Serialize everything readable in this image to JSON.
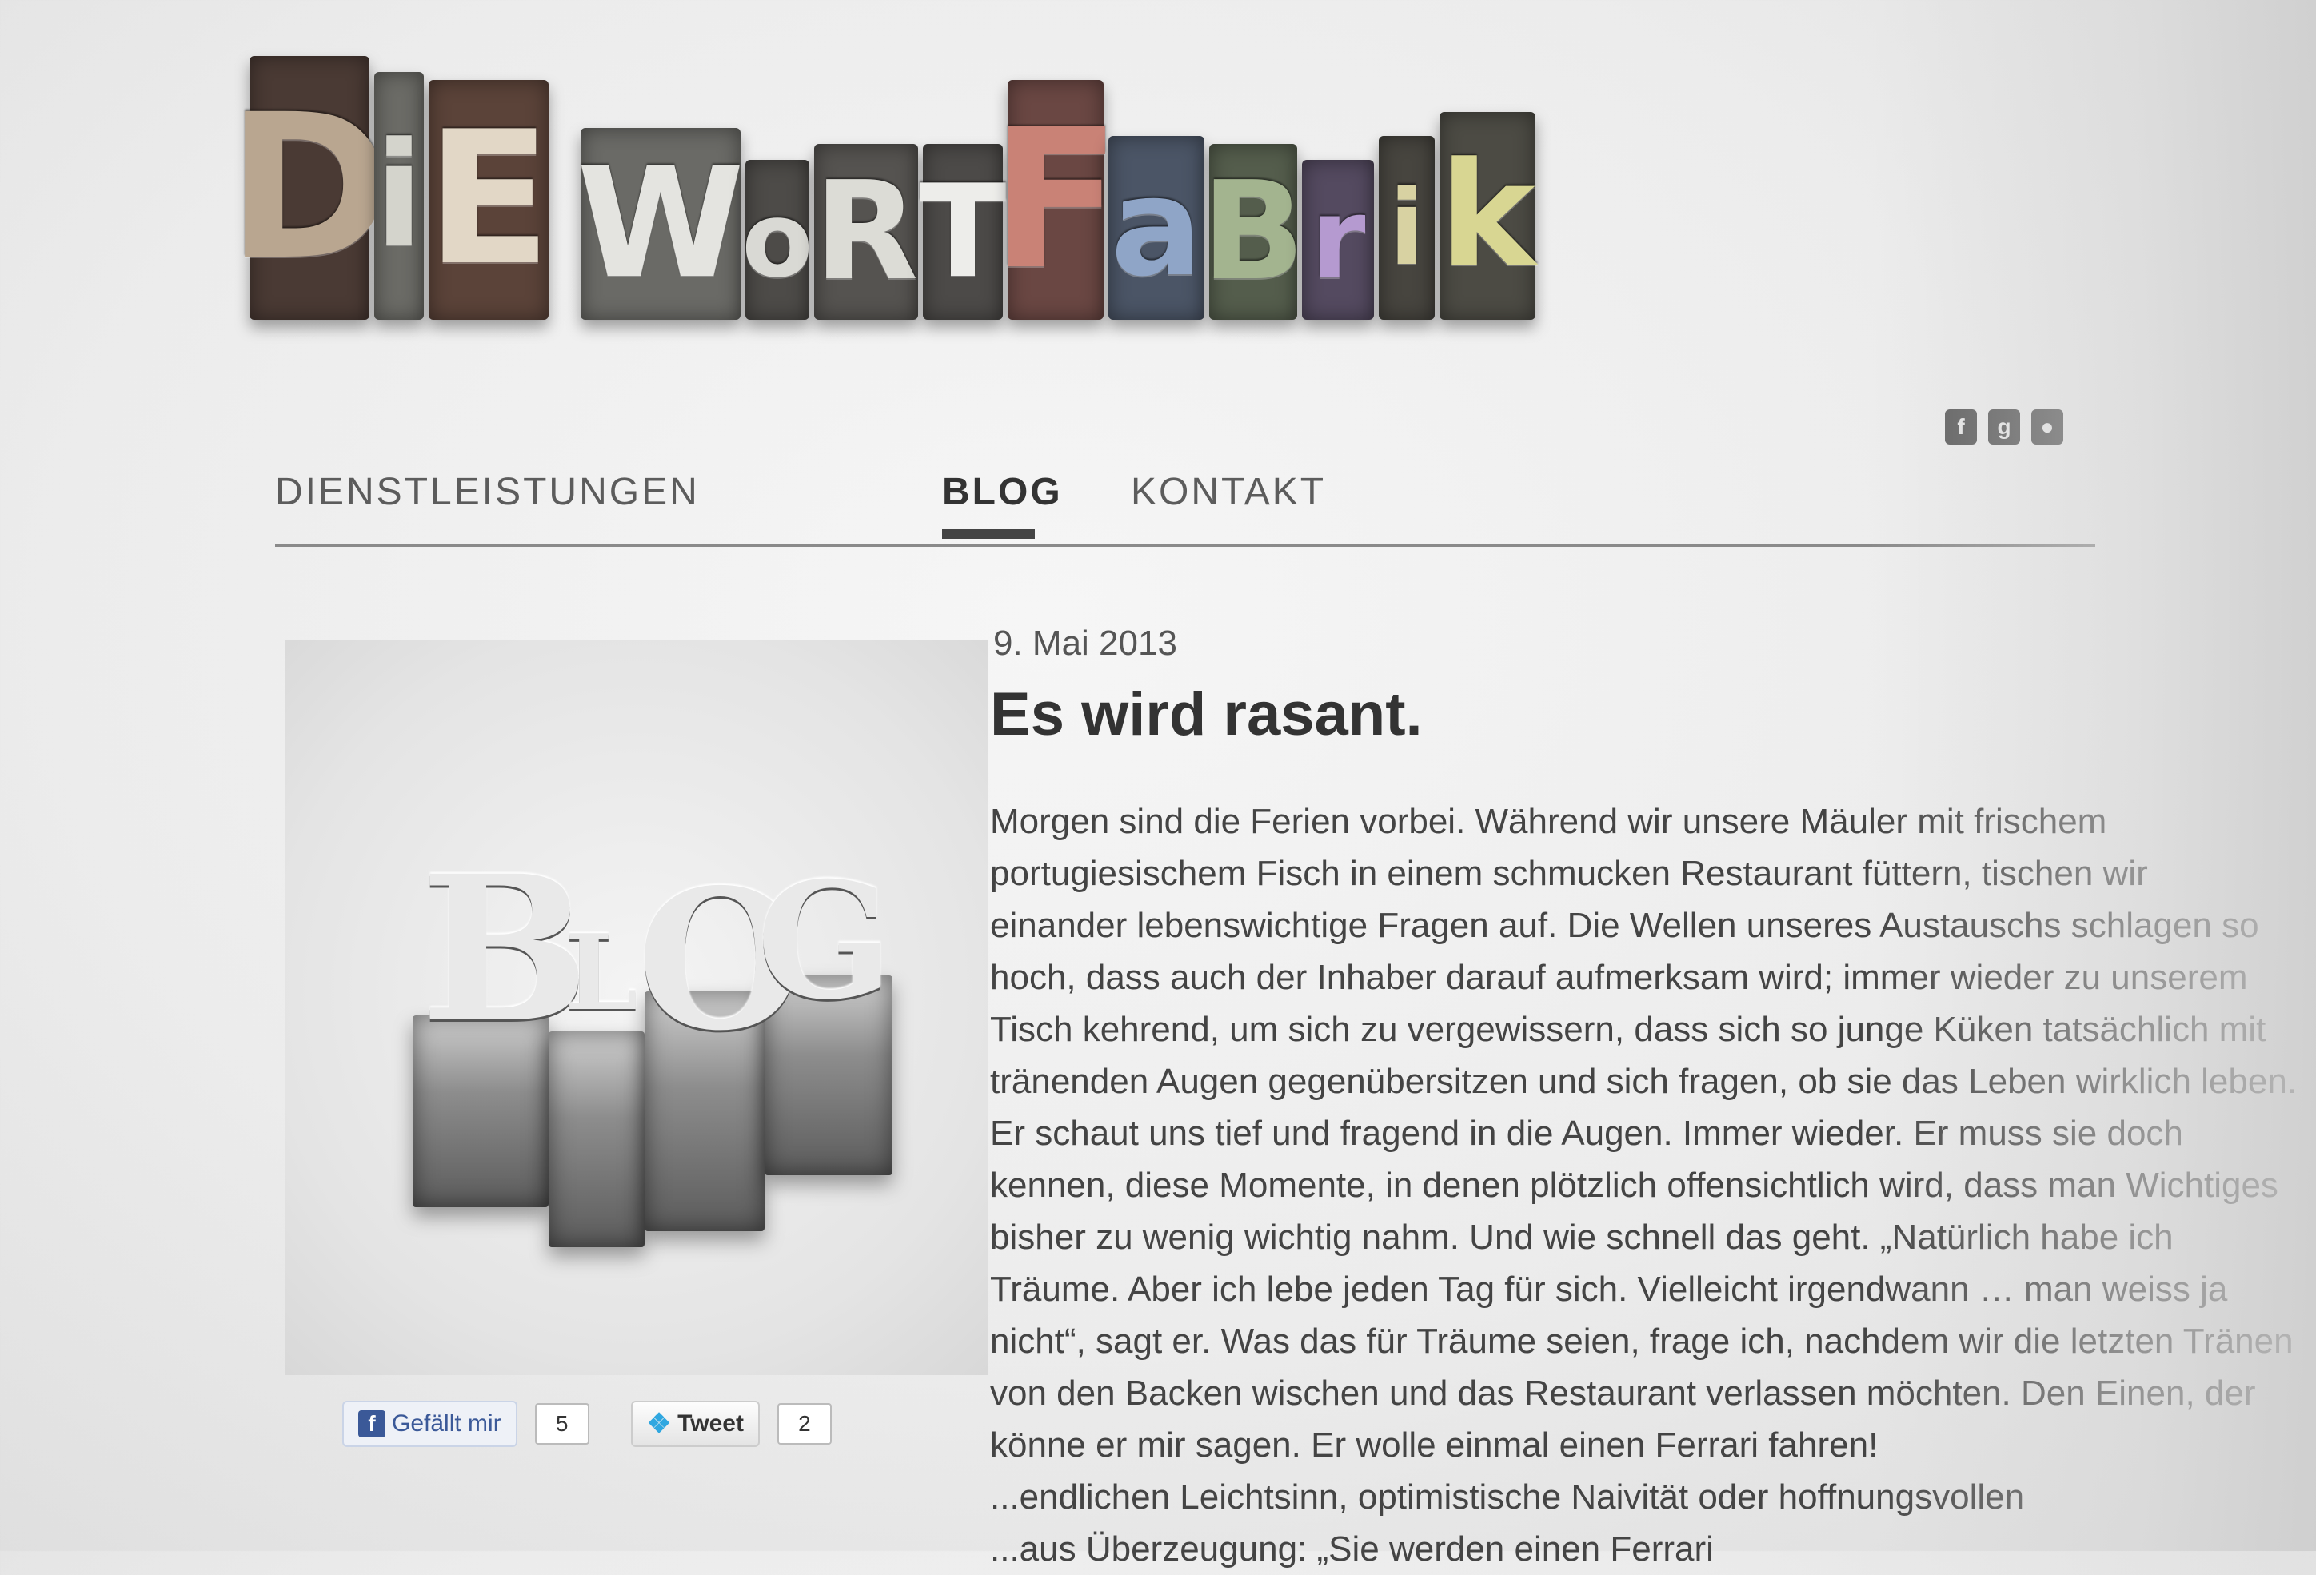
{
  "logo": {
    "word1": [
      "D",
      "i",
      "E"
    ],
    "word2": [
      "W",
      "o",
      "R",
      "T",
      "F",
      "a",
      "B",
      "r",
      "i",
      "k"
    ]
  },
  "social": [
    "fb-icon",
    "g-icon",
    "flickr-icon"
  ],
  "nav": {
    "items": [
      {
        "label": "DIENSTLEISTUNGEN",
        "active": false
      },
      {
        "label": "BLOG",
        "active": true
      },
      {
        "label": "KONTAKT",
        "active": false
      }
    ]
  },
  "post": {
    "image": {
      "letters": [
        "B",
        "L",
        "O",
        "G"
      ]
    },
    "date": "9. Mai 2013",
    "title": "Es wird rasant.",
    "lines": [
      "Morgen sind die Ferien vorbei. Während wir unsere Mäuler mit frischem",
      "portugiesischem Fisch in einem schmucken Restaurant füttern, tischen wir",
      "einander lebenswichtige Fragen auf. Die Wellen unseres Austauschs schlagen so",
      "hoch, dass auch der Inhaber darauf aufmerksam wird; immer wieder zu unserem",
      "Tisch kehrend, um sich zu vergewissern, dass sich so junge Küken tatsächlich mit",
      "tränenden Augen gegenübersitzen und sich fragen, ob sie das Leben wirklich leben.",
      "Er schaut uns tief und fragend in die Augen. Immer wieder. Er muss sie doch",
      "kennen, diese Momente, in denen plötzlich offensichtlich wird, dass man Wichtiges",
      "bisher zu wenig wichtig nahm. Und wie schnell das geht. „Natürlich habe ich",
      "Träume. Aber ich lebe jeden Tag für sich. Vielleicht irgendwann … man weiss ja",
      "nicht“, sagt er. Was das für Träume seien, frage ich, nachdem wir die letzten Tränen",
      "von den Backen wischen und das Restaurant verlassen möchten. Den Einen, der",
      "könne er mir sagen. Er wolle einmal einen Ferrari fahren!",
      "...endlichen Leichtsinn, optimistische Naivität oder hoffnungsvollen",
      "...aus Überzeugung: „Sie werden einen Ferrari"
    ]
  },
  "share": {
    "like_label": "Gefällt mir",
    "like_count": "5",
    "tweet_label": "Tweet",
    "tweet_count": "2"
  }
}
